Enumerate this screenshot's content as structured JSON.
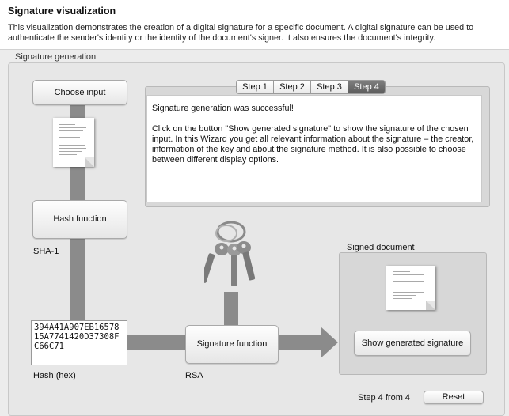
{
  "header": {
    "title": "Signature visualization",
    "description": "This visualization demonstrates the creation of a digital signature for a specific document. A digital signature can be used to authenticate the sender's identity or the identity of the document's signer. It also ensures the document's integrity."
  },
  "group": {
    "label": "Signature generation"
  },
  "buttons": {
    "choose_input": "Choose input",
    "hash_function": "Hash function",
    "signature_function": "Signature function",
    "show_signature": "Show generated signature",
    "reset": "Reset"
  },
  "tabs": [
    {
      "label": "Step 1",
      "active": false
    },
    {
      "label": "Step 2",
      "active": false
    },
    {
      "label": "Step 3",
      "active": false
    },
    {
      "label": "Step 4",
      "active": true
    }
  ],
  "wizard": {
    "paragraph1": "Signature generation was successful!",
    "paragraph2": "Click on the button \"Show generated signature\" to show the signature of the chosen input. In this Wizard you get all relevant information about the signature – the creator, information of the key and about the signature method. It is also possible to choose between different display options."
  },
  "labels": {
    "hash_algorithm": "SHA-1",
    "hash_hex": "Hash (hex)",
    "signature_algorithm": "RSA",
    "signed_document": "Signed document",
    "step_counter": "Step 4 from 4"
  },
  "hash_value": "394A41A907EB16578\n15A7741420D37308F\nC66C71",
  "icons": {
    "document": "document-icon",
    "keys": "keys-icon",
    "arrow": "arrow-right-icon"
  },
  "colors": {
    "flow_bar": "#8b8b8b",
    "active_tab": "#6a6a6a"
  }
}
